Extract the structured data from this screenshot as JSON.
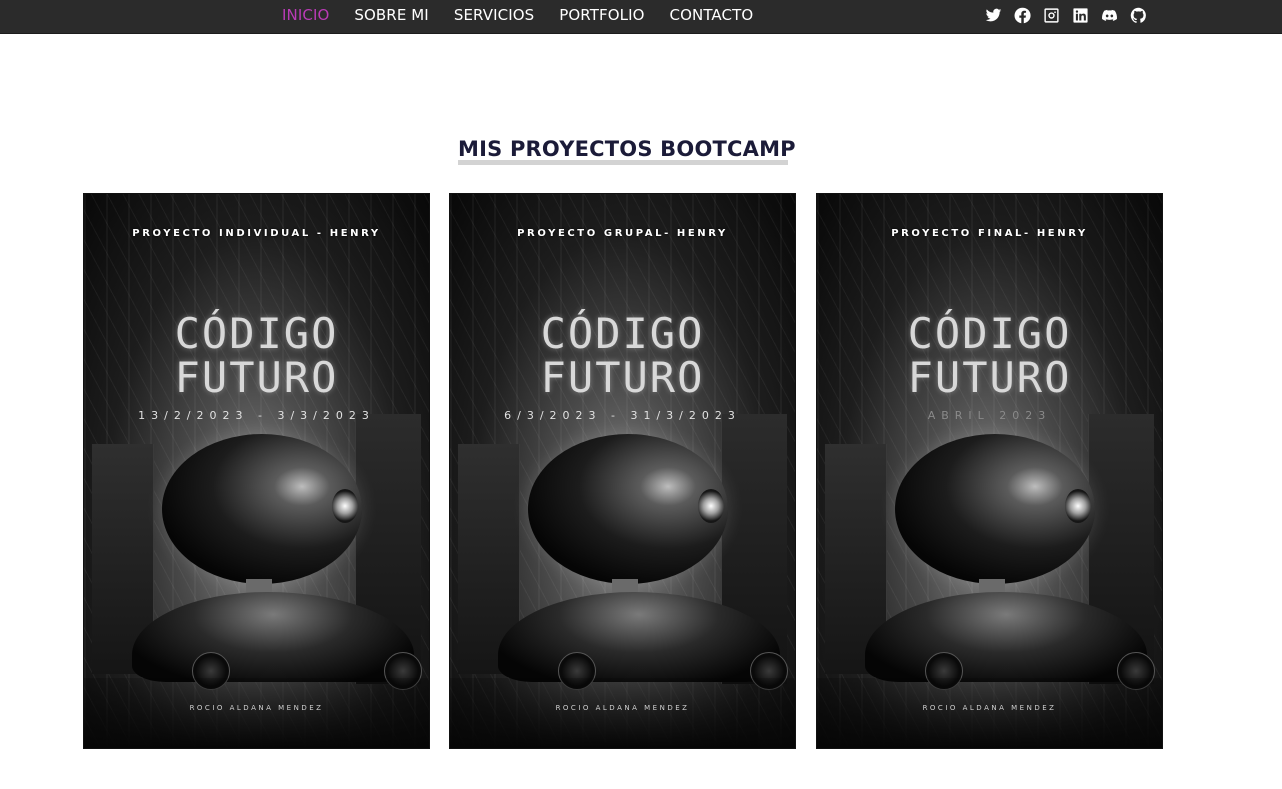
{
  "nav": {
    "items": [
      {
        "label": "INICIO",
        "active": true
      },
      {
        "label": "SOBRE MI",
        "active": false
      },
      {
        "label": "SERVICIOS",
        "active": false
      },
      {
        "label": "PORTFOLIO",
        "active": false
      },
      {
        "label": "CONTACTO",
        "active": false
      }
    ],
    "active_color": "#b93bb6",
    "background": "#2b2b2b"
  },
  "social": {
    "icons": [
      "twitter-icon",
      "facebook-icon",
      "instagram-icon",
      "linkedin-icon",
      "discord-icon",
      "github-icon"
    ]
  },
  "section": {
    "title": "MIS PROYECTOS BOOTCAMP"
  },
  "projects": [
    {
      "top_label": "PROYECTO INDIVIDUAL - HENRY",
      "title_line1": "CÓDIGO",
      "title_line2": "FUTURO",
      "dates": "13/2/2023 - 3/3/2023",
      "author": "ROCIO ALDANA MENDEZ"
    },
    {
      "top_label": "PROYECTO GRUPAL- HENRY",
      "title_line1": "CÓDIGO",
      "title_line2": "FUTURO",
      "dates": "6/3/2023 - 31/3/2023",
      "author": "ROCIO ALDANA MENDEZ"
    },
    {
      "top_label": "PROYECTO FINAL- HENRY",
      "title_line1": "CÓDIGO",
      "title_line2": "FUTURO",
      "dates": "ABRIL 2023",
      "author": "ROCIO ALDANA MENDEZ"
    }
  ]
}
